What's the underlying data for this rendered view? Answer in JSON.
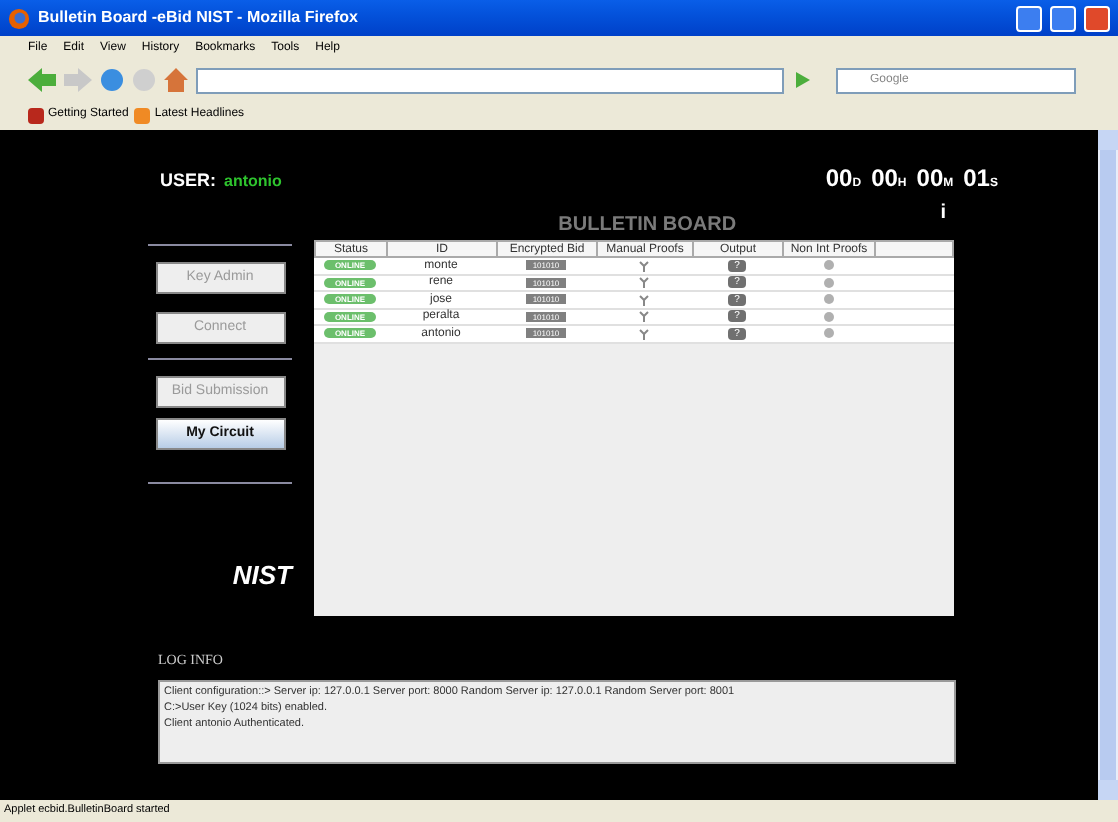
{
  "window": {
    "title": "Bulletin Board -eBid NIST - Mozilla Firefox"
  },
  "menu": [
    "File",
    "Edit",
    "View",
    "History",
    "Bookmarks",
    "Tools",
    "Help"
  ],
  "search": {
    "placeholder": "Google"
  },
  "bookmarks": [
    "Getting Started",
    "Latest Headlines"
  ],
  "logo": "NIST",
  "user": {
    "label": "USER:",
    "name": "antonio"
  },
  "timer": [
    {
      "value": "00",
      "unit": "D"
    },
    {
      "value": "00",
      "unit": "H"
    },
    {
      "value": "00",
      "unit": "M"
    },
    {
      "value": "01",
      "unit": "S"
    }
  ],
  "nav": [
    {
      "label": "Key Admin",
      "disabled": true
    },
    {
      "label": "Connect",
      "disabled": true
    },
    {
      "label": "Bid Submission",
      "disabled": true
    },
    {
      "label": "My Circuit",
      "disabled": false
    }
  ],
  "board": {
    "title": "BULLETIN BOARD",
    "info": "i",
    "columns": [
      "Status",
      "ID",
      "Encrypted Bid",
      "Manual Proofs",
      "Output",
      "Non Int Proofs"
    ],
    "rows": [
      {
        "status": "ONLINE",
        "id": "monte",
        "bid": "101010",
        "output": "?"
      },
      {
        "status": "ONLINE",
        "id": "rene",
        "bid": "101010",
        "output": "?"
      },
      {
        "status": "ONLINE",
        "id": "jose",
        "bid": "101010",
        "output": "?"
      },
      {
        "status": "ONLINE",
        "id": "peralta",
        "bid": "101010",
        "output": "?"
      },
      {
        "status": "ONLINE",
        "id": "antonio",
        "bid": "101010",
        "output": "?"
      }
    ]
  },
  "log": {
    "title": "LOG INFO",
    "lines": [
      "Client configuration::> Server ip: 127.0.0.1 Server port: 8000 Random Server ip: 127.0.0.1 Random Server port: 8001",
      "C:>User Key (1024 bits) enabled.",
      "Client antonio Authenticated."
    ]
  },
  "status_bar": "Applet ecbid.BulletinBoard started"
}
